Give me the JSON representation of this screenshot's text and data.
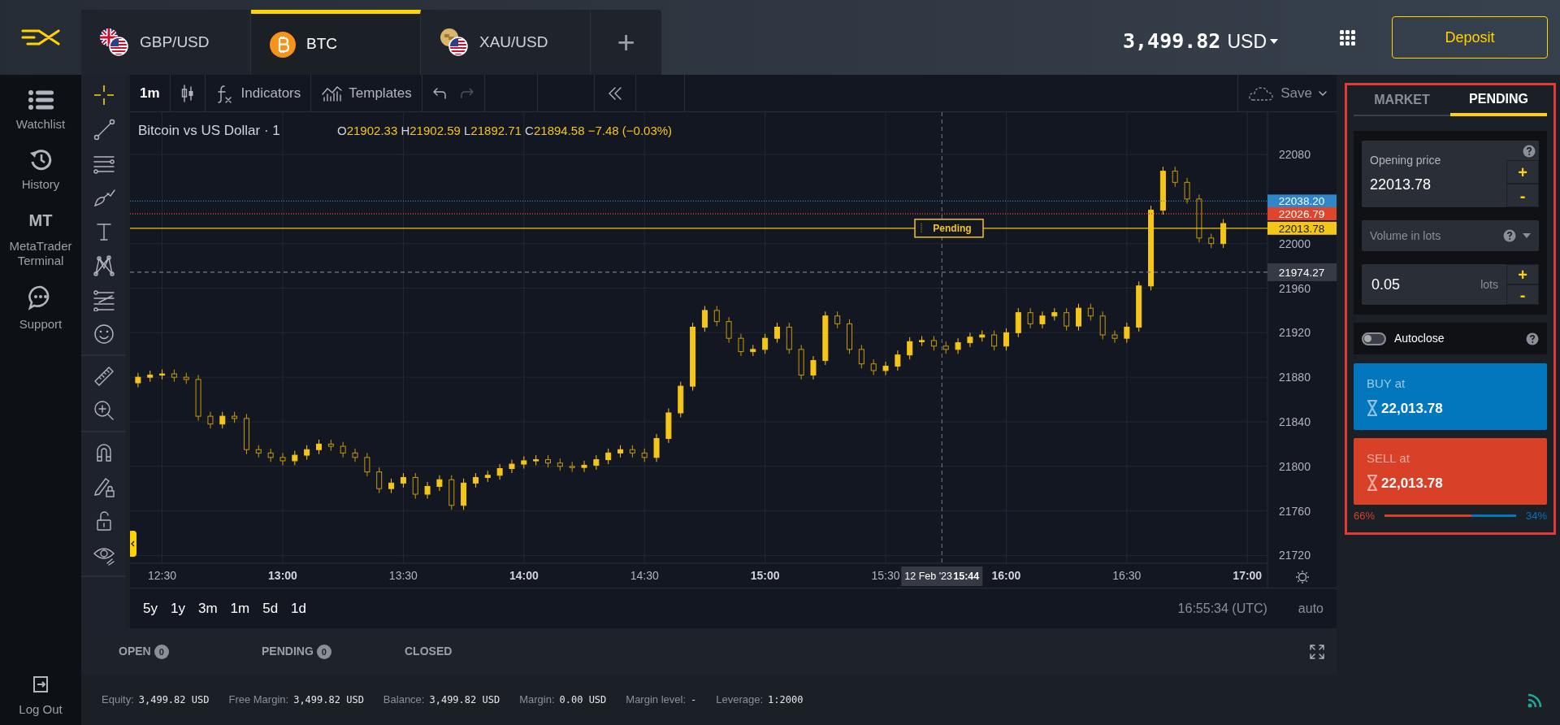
{
  "top_bar": {
    "tabs": [
      {
        "label": "GBP/USD",
        "kind": "forex",
        "selected": false
      },
      {
        "label": "BTC",
        "kind": "crypto",
        "selected": true
      },
      {
        "label": "XAU/USD",
        "kind": "metal",
        "selected": false
      }
    ],
    "add": "+",
    "balance": "3,499.82",
    "currency": "USD",
    "deposit": "Deposit"
  },
  "sidebar": {
    "items": [
      {
        "label": "Watchlist",
        "kind": "list"
      },
      {
        "label": "History",
        "kind": "history"
      },
      {
        "label": "MetaTrader Terminal",
        "kind": "badge",
        "badge": "MT"
      },
      {
        "label": "Support",
        "kind": "chat"
      }
    ],
    "logout": "Log Out"
  },
  "chart_toolbar": {
    "interval": "1m",
    "indicators": "Indicators",
    "templates": "Templates",
    "save": "Save"
  },
  "chart": {
    "title": "Bitcoin vs US Dollar · 1",
    "ohlc": [
      {
        "key": "O",
        "value": "21902.33"
      },
      {
        "key": "H",
        "value": "21902.59"
      },
      {
        "key": "L",
        "value": "21892.71"
      },
      {
        "key": "C",
        "value": "21894.58"
      }
    ],
    "change": "−7.48 (−0.03%)",
    "crosshair_date": "12 Feb '23",
    "crosshair_time": "15:44",
    "chart_data": {
      "type": "candlestick",
      "grid": true,
      "xlim": [
        742,
        1025
      ],
      "ylim": [
        21713,
        22118
      ],
      "x": [
        744,
        747,
        750,
        753,
        756,
        759,
        762,
        765,
        768,
        771,
        774,
        777,
        780,
        783,
        786,
        789,
        792,
        795,
        798,
        801,
        804,
        807,
        810,
        813,
        816,
        819,
        822,
        825,
        828,
        831,
        834,
        837,
        840,
        843,
        846,
        849,
        852,
        855,
        858,
        861,
        864,
        867,
        870,
        873,
        876,
        879,
        882,
        885,
        888,
        891,
        894,
        897,
        900,
        903,
        906,
        909,
        912,
        915,
        918,
        921,
        924,
        927,
        930,
        933,
        936,
        939,
        942,
        945,
        948,
        951,
        954,
        957,
        960,
        963,
        966,
        969,
        972,
        975,
        978,
        981,
        984,
        987,
        990,
        993,
        996,
        999,
        1002,
        1005,
        1008,
        1011,
        1014
      ],
      "ohlc": [
        [
          21875,
          21884,
          21871,
          21880
        ],
        [
          21880,
          21886,
          21876,
          21882
        ],
        [
          21882,
          21887,
          21878,
          21883
        ],
        [
          21883,
          21887,
          21876,
          21880
        ],
        [
          21880,
          21884,
          21874,
          21878
        ],
        [
          21878,
          21882,
          21841,
          21845
        ],
        [
          21845,
          21849,
          21834,
          21838
        ],
        [
          21838,
          21849,
          21834,
          21845
        ],
        [
          21845,
          21849,
          21839,
          21843
        ],
        [
          21843,
          21847,
          21811,
          21815
        ],
        [
          21815,
          21819,
          21808,
          21812
        ],
        [
          21812,
          21816,
          21804,
          21808
        ],
        [
          21808,
          21812,
          21801,
          21805
        ],
        [
          21805,
          21814,
          21801,
          21810
        ],
        [
          21810,
          21819,
          21806,
          21815
        ],
        [
          21815,
          21824,
          21811,
          21820
        ],
        [
          21820,
          21824,
          21814,
          21818
        ],
        [
          21818,
          21822,
          21808,
          21812
        ],
        [
          21812,
          21816,
          21804,
          21808
        ],
        [
          21808,
          21812,
          21791,
          21795
        ],
        [
          21795,
          21799,
          21776,
          21780
        ],
        [
          21780,
          21789,
          21776,
          21785
        ],
        [
          21785,
          21794,
          21781,
          21790
        ],
        [
          21790,
          21794,
          21771,
          21775
        ],
        [
          21775,
          21786,
          21771,
          21782
        ],
        [
          21782,
          21792,
          21778,
          21788
        ],
        [
          21788,
          21792,
          21761,
          21765
        ],
        [
          21765,
          21789,
          21761,
          21785
        ],
        [
          21785,
          21794,
          21781,
          21790
        ],
        [
          21790,
          21796,
          21786,
          21792
        ],
        [
          21792,
          21802,
          21788,
          21798
        ],
        [
          21798,
          21806,
          21794,
          21802
        ],
        [
          21802,
          21809,
          21798,
          21805
        ],
        [
          21805,
          21810,
          21801,
          21806
        ],
        [
          21806,
          21810,
          21799,
          21803
        ],
        [
          21803,
          21807,
          21796,
          21800
        ],
        [
          21800,
          21804,
          21795,
          21799
        ],
        [
          21799,
          21805,
          21795,
          21801
        ],
        [
          21801,
          21810,
          21797,
          21806
        ],
        [
          21806,
          21816,
          21802,
          21812
        ],
        [
          21812,
          21819,
          21808,
          21815
        ],
        [
          21815,
          21819,
          21808,
          21812
        ],
        [
          21812,
          21816,
          21804,
          21808
        ],
        [
          21808,
          21829,
          21804,
          21825
        ],
        [
          21825,
          21852,
          21821,
          21848
        ],
        [
          21848,
          21876,
          21844,
          21872
        ],
        [
          21872,
          21929,
          21868,
          21925
        ],
        [
          21925,
          21944,
          21921,
          21940
        ],
        [
          21940,
          21944,
          21926,
          21930
        ],
        [
          21930,
          21934,
          21911,
          21915
        ],
        [
          21915,
          21919,
          21899,
          21903
        ],
        [
          21903,
          21909,
          21899,
          21905
        ],
        [
          21905,
          21919,
          21901,
          21915
        ],
        [
          21915,
          21929,
          21911,
          21925
        ],
        [
          21925,
          21929,
          21901,
          21905
        ],
        [
          21905,
          21909,
          21878,
          21882
        ],
        [
          21882,
          21899,
          21878,
          21895
        ],
        [
          21895,
          21939,
          21891,
          21935
        ],
        [
          21935,
          21939,
          21924,
          21928
        ],
        [
          21928,
          21932,
          21901,
          21905
        ],
        [
          21905,
          21909,
          21888,
          21892
        ],
        [
          21892,
          21896,
          21882,
          21886
        ],
        [
          21886,
          21894,
          21882,
          21890
        ],
        [
          21890,
          21904,
          21886,
          21900
        ],
        [
          21900,
          21916,
          21896,
          21912
        ],
        [
          21912,
          21917,
          21908,
          21913
        ],
        [
          21913,
          21917,
          21904,
          21908
        ],
        [
          21908,
          21912,
          21901,
          21905
        ],
        [
          21905,
          21915,
          21901,
          21911
        ],
        [
          21911,
          21920,
          21907,
          21916
        ],
        [
          21916,
          21922,
          21912,
          21918
        ],
        [
          21918,
          21922,
          21904,
          21908
        ],
        [
          21908,
          21924,
          21904,
          21920
        ],
        [
          21920,
          21942,
          21916,
          21938
        ],
        [
          21938,
          21942,
          21924,
          21928
        ],
        [
          21928,
          21939,
          21924,
          21935
        ],
        [
          21935,
          21942,
          21931,
          21938
        ],
        [
          21938,
          21942,
          21922,
          21926
        ],
        [
          21926,
          21946,
          21922,
          21942
        ],
        [
          21942,
          21946,
          21931,
          21935
        ],
        [
          21935,
          21939,
          21914,
          21918
        ],
        [
          21918,
          21922,
          21911,
          21915
        ],
        [
          21915,
          21929,
          21911,
          21925
        ],
        [
          21925,
          21966,
          21921,
          21962
        ],
        [
          21962,
          22034,
          21958,
          22030
        ],
        [
          22030,
          22069,
          22026,
          22065
        ],
        [
          22065,
          22069,
          22051,
          22055
        ],
        [
          22055,
          22059,
          22036,
          22040
        ],
        [
          22040,
          22044,
          22001,
          22005
        ],
        [
          22005,
          22009,
          21996,
          22000
        ],
        [
          22000,
          22022,
          21996,
          22018
        ]
      ],
      "xticks": [
        {
          "value": 750,
          "label": "12:30"
        },
        {
          "value": 780,
          "label": "13:00"
        },
        {
          "value": 810,
          "label": "13:30"
        },
        {
          "value": 840,
          "label": "14:00"
        },
        {
          "value": 870,
          "label": "14:30"
        },
        {
          "value": 900,
          "label": "15:00"
        },
        {
          "value": 930,
          "label": "15:30"
        },
        {
          "value": 960,
          "label": "16:00"
        },
        {
          "value": 990,
          "label": "16:30"
        },
        {
          "value": 1020,
          "label": "17:00"
        }
      ],
      "yticks": [
        21720,
        21760,
        21800,
        21840,
        21880,
        21920,
        21960,
        22000,
        22080
      ],
      "ref_lines": [
        {
          "axis": "y",
          "value": 22038.2,
          "label": "22038.20",
          "color": "#2f86c9"
        },
        {
          "axis": "y",
          "value": 22026.79,
          "label": "22026.79",
          "color": "#e0452b"
        },
        {
          "axis": "y",
          "value": 22013.78,
          "label": "22013.78",
          "color": "#f5c518"
        },
        {
          "axis": "y",
          "value": 21974.27,
          "label": "21974.27",
          "color": "#787b86"
        },
        {
          "axis": "x",
          "value": 944,
          "color": "#787b86"
        }
      ],
      "annotations": [
        "Pending"
      ]
    }
  },
  "ranges": [
    "5y",
    "1y",
    "3m",
    "1m",
    "5d",
    "1d"
  ],
  "clock": "16:55:34 (UTC)",
  "scale": "auto",
  "positions_tabs": [
    {
      "label": "OPEN",
      "count": "0",
      "selected": false
    },
    {
      "label": "PENDING",
      "count": "0",
      "selected": false
    },
    {
      "label": "CLOSED",
      "selected": false
    }
  ],
  "status_bar": [
    {
      "label": "Equity:",
      "value": "3,499.82 USD"
    },
    {
      "label": "Free Margin:",
      "value": "3,499.82 USD"
    },
    {
      "label": "Balance:",
      "value": "3,499.82 USD"
    },
    {
      "label": "Margin:",
      "value": "0.00 USD"
    },
    {
      "label": "Margin level:",
      "value": "-"
    },
    {
      "label": "Leverage:",
      "value": "1:2000"
    }
  ],
  "order_panel": {
    "tabs": [
      {
        "label": "MARKET",
        "selected": false
      },
      {
        "label": "PENDING",
        "selected": true
      }
    ],
    "opening_price": {
      "label": "Opening price",
      "value": "22013.78",
      "plus": "+",
      "minus": "-"
    },
    "volume": {
      "label": "Volume in lots"
    },
    "lots": {
      "value": "0.05",
      "unit": "lots",
      "plus": "+",
      "minus": "-"
    },
    "autoclose": {
      "label": "Autoclose",
      "on": false
    },
    "buy": {
      "label": "BUY at",
      "price": "22,013.78"
    },
    "sell": {
      "label": "SELL at",
      "price": "22,013.78"
    },
    "sentiment": {
      "sell": "66%",
      "buy": "34%",
      "level": 0.66
    }
  }
}
